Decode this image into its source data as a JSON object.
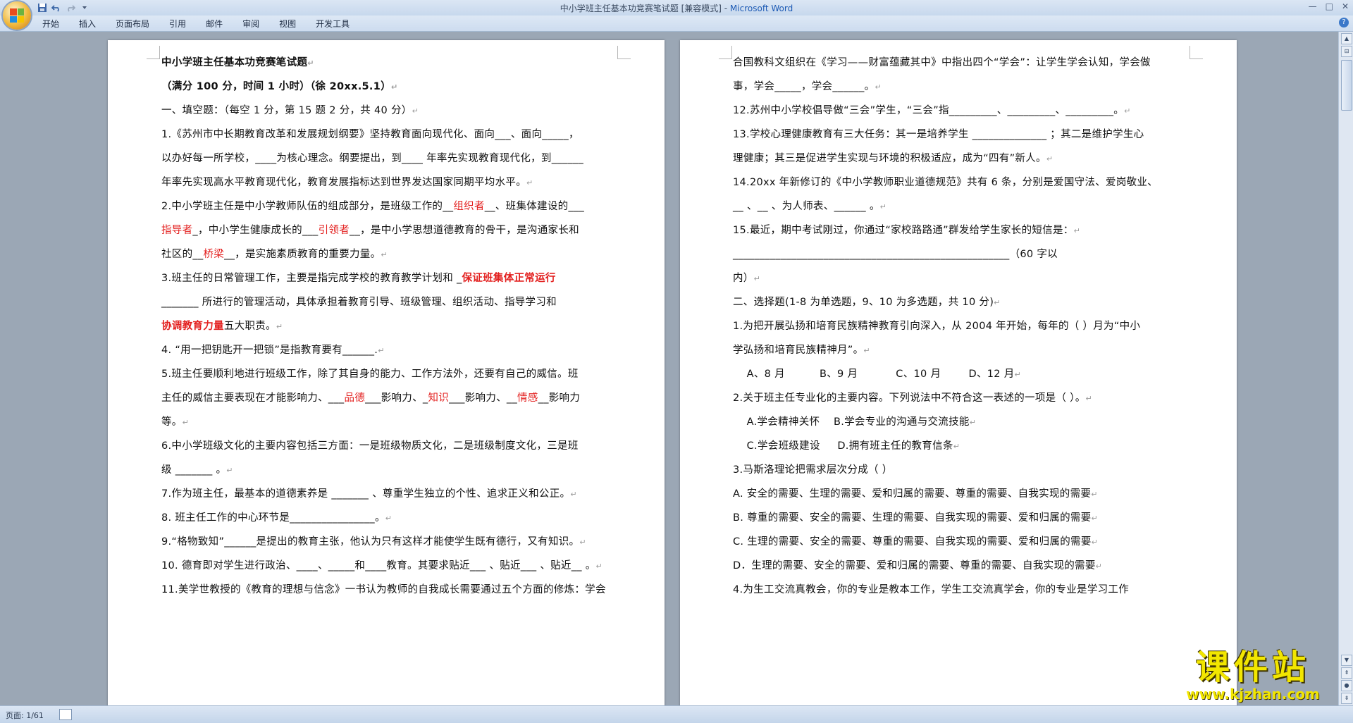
{
  "window": {
    "title": "中小学班主任基本功竞赛笔试题 [兼容模式] - ",
    "app_name": "Microsoft Word",
    "controls": [
      "—",
      "□",
      "✕"
    ]
  },
  "ribbon_tabs": [
    "开始",
    "插入",
    "页面布局",
    "引用",
    "邮件",
    "审阅",
    "视图",
    "开发工具"
  ],
  "quick_access": [
    "save-icon",
    "undo-icon",
    "redo-icon",
    "customize-icon"
  ],
  "status_bar": {
    "page": "页面: 1/61"
  },
  "watermark": {
    "title": "课件站",
    "url": "www.kjzhan.com"
  },
  "left_page": {
    "title": "中小学班主任基本功竞赛笔试题",
    "subtitle": "（满分 100 分，时间 1 小时）（徐 20xx.5.1）",
    "section1": "一、填空题：（每空 1 分，第 15 题 2 分，共 40 分）",
    "q1_l1": "1.《苏州市中长期教育改革和发展规划纲要》坚持教育面向现代化、面向___、面向_____，",
    "q1_l2": "以办好每一所学校，____为核心理念。纲要提出，到____ 年率先实现教育现代化，到______",
    "q1_l3": "年率先实现高水平教育现代化，教育发展指标达到世界发达国家同期平均水平。",
    "q2_l1_a": "2.中小学班主任是中小学教师队伍的组成部分，是班级工作的__",
    "q2_l1_red": "组织者",
    "q2_l1_b": "__、班集体建设的___",
    "q2_l2_red1": "指导者",
    "q2_l2_a": "_，中小学生健康成长的___",
    "q2_l2_red2": "引领者",
    "q2_l2_b": "__，是中小学思想道德教育的骨干，是沟通家长和",
    "q2_l3_a": "社区的__",
    "q2_l3_red": "桥梁",
    "q2_l3_b": "__，是实施素质教育的重要力量。",
    "q3_l1_a": "3.班主任的日常管理工作，主要是指完成学校的教育教学计划和 _",
    "q3_l1_red": "保证班集体正常运行",
    "q3_l2": "_______ 所进行的管理活动，具体承担着教育引导、班级管理、组织活动、指导学习和",
    "q3_l3_red": "协调教育力量",
    "q3_l3_b": "五大职责。",
    "q4": "4. “用一把钥匙开一把锁”是指教育要有______.",
    "q5_l1": "5.班主任要顺利地进行班级工作，除了其自身的能力、工作方法外，还要有自己的威信。班",
    "q5_l2_a": "主任的威信主要表现在才能影响力、___",
    "q5_l2_red1": "品德",
    "q5_l2_b": "___影响力、_",
    "q5_l2_red2": "知识",
    "q5_l2_c": "___影响力、__",
    "q5_l2_red3": "情感",
    "q5_l2_d": "__影响力",
    "q5_l3": "等。",
    "q6_l1": "6.中小学班级文化的主要内容包括三方面：一是班级物质文化，二是班级制度文化，三是班",
    "q6_l2": "级 _______ 。",
    "q7": "7.作为班主任，最基本的道德素养是 _______ 、尊重学生独立的个性、追求正义和公正。",
    "q8": "8. 班主任工作的中心环节是________________。",
    "q9": "9.“格物致知”______是提出的教育主张，他认为只有这样才能使学生既有德行，又有知识。",
    "q10": "10. 德育即对学生进行政治、____、_____和____教育。其要求贴近___ 、贴近___ 、贴近__ 。",
    "q11_partial": "11.美学世教授的《教育的理想与信念》一书认为教师的自我成长需要通过五个方面的修炼：学会"
  },
  "right_page": {
    "l1": "合国教科文组织在《学习——财富蕴藏其中》中指出四个“学会”：让学生学会认知，学会做",
    "l2": "事，学会_____，学会______。",
    "l3": "12.苏州中小学校倡导做“三会”学生，“三会”指_________、_________、_________。",
    "l4": "13.学校心理健康教育有三大任务：其一是培养学生 ______________ ；其二是维护学生心",
    "l5": "理健康；其三是促进学生实现与环境的积极适应，成为“四有”新人。",
    "l6": "14.20xx 年新修订的《中小学教师职业道德规范》共有 6 条，分别是爱国守法、爱岗敬业、",
    "l7": "__ 、__ 、为人师表、______ 。",
    "l8": "15.最近，期中考试刚过，你通过“家校路路通”群发给学生家长的短信是：",
    "l9": "____________________________________________________（60 字以",
    "l10": "内）",
    "l11": "二、选择题(1-8 为单选题，9、10 为多选题，共 10 分)",
    "l12": " 1.为把开展弘扬和培育民族精神教育引向深入，从 2004 年开始，每年的（     ）月为“中小",
    "l13": "学弘扬和培育民族精神月”。",
    "l14": "    A、8 月          B、9 月           C、10 月        D、12 月",
    "l15": " 2.关于班主任专业化的主要内容。下列说法中不符合这一表述的一项是（ ）。",
    "l16": "    A.学会精神关怀    B.学会专业的沟通与交流技能",
    "l17": "    C.学会班级建设     D.拥有班主任的教育信条",
    "l18": " 3.马斯洛理论把需求层次分成（   ）",
    "l19": "A. 安全的需要、生理的需要、爱和归属的需要、尊重的需要、自我实现的需要",
    "l20": "B. 尊重的需要、安全的需要、生理的需要、自我实现的需要、爱和归属的需要",
    "l21": "C. 生理的需要、安全的需要、尊重的需要、自我实现的需要、爱和归属的需要",
    "l22": "D．生理的需要、安全的需要、爱和归属的需要、尊重的需要、自我实现的需要",
    "l23_partial": " 4.为生工交流真教会，你的专业是教本工作，学生工交流真学会，你的专业是学习工作"
  },
  "paragraph_mark": "↵"
}
